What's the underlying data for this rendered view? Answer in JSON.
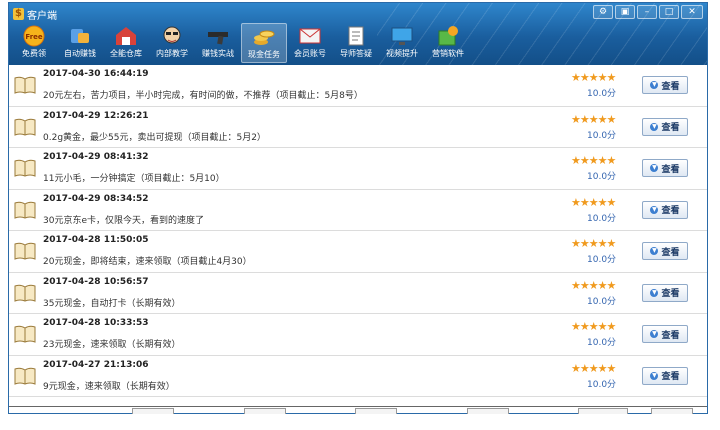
{
  "app": {
    "title": "客户端",
    "icon": "app-logo-icon"
  },
  "window_controls": [
    "settings-icon",
    "skin-icon",
    "minimize-icon",
    "maximize-icon",
    "close-icon"
  ],
  "toolbar": [
    {
      "label": "免费领",
      "icon": "free-badge-icon"
    },
    {
      "label": "自动赚钱",
      "icon": "auto-earn-icon"
    },
    {
      "label": "全能仓库",
      "icon": "warehouse-icon"
    },
    {
      "label": "内部教学",
      "icon": "teacher-icon"
    },
    {
      "label": "赚钱实战",
      "icon": "gun-icon"
    },
    {
      "label": "现金任务",
      "icon": "coins-icon",
      "active": true
    },
    {
      "label": "会员账号",
      "icon": "envelope-icon"
    },
    {
      "label": "导师答疑",
      "icon": "document-icon"
    },
    {
      "label": "视频提升",
      "icon": "monitor-icon"
    },
    {
      "label": "营销软件",
      "icon": "software-icon"
    }
  ],
  "tasks": [
    {
      "title": "2017-04-30 16:44:19",
      "desc": "20元左右，苦力项目，半小时完成，有时间的做，不推荐（项目截止：5月8号）",
      "stars": "★★★★★",
      "score": "10.0分",
      "button": "查看"
    },
    {
      "title": "2017-04-29 12:26:21",
      "desc": "0.2g黄金，最少55元，卖出可提现（项目截止：5月2）",
      "stars": "★★★★★",
      "score": "10.0分",
      "button": "查看"
    },
    {
      "title": "2017-04-29 08:41:32",
      "desc": "11元小毛，一分钟搞定（项目截止：5月10）",
      "stars": "★★★★★",
      "score": "10.0分",
      "button": "查看"
    },
    {
      "title": "2017-04-29 08:34:52",
      "desc": "30元京东e卡，仅限今天，看到的速度了",
      "stars": "★★★★★",
      "score": "10.0分",
      "button": "查看"
    },
    {
      "title": "2017-04-28 11:50:05",
      "desc": "20元现金，即将结束，速来领取（项目截止4月30）",
      "stars": "★★★★★",
      "score": "10.0分",
      "button": "查看"
    },
    {
      "title": "2017-04-28 10:56:57",
      "desc": "35元现金，自动打卡（长期有效）",
      "stars": "★★★★★",
      "score": "10.0分",
      "button": "查看"
    },
    {
      "title": "2017-04-28 10:33:53",
      "desc": "23元现金，速来领取（长期有效）",
      "stars": "★★★★★",
      "score": "10.0分",
      "button": "查看"
    },
    {
      "title": "2017-04-27 21:13:06",
      "desc": "9元现金，速来领取（长期有效）",
      "stars": "★★★★★",
      "score": "10.0分",
      "button": "查看"
    }
  ],
  "colors": {
    "header": "#1a5e9e",
    "accent": "#f09a1e",
    "score": "#3566b0"
  }
}
